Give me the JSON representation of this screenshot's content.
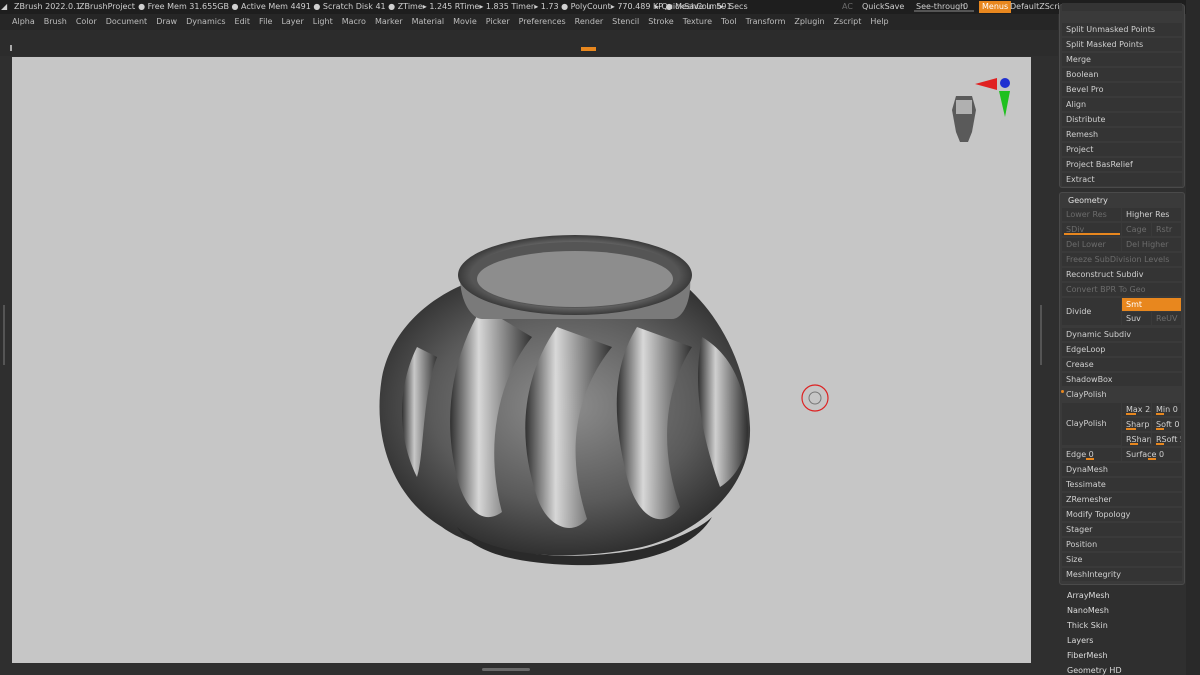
{
  "titlebar": {
    "app": "ZBrush 2022.0.1",
    "project": "ZBrushProject",
    "stats": ". ● Free Mem 31.655GB ● Active Mem 4491 ● Scratch Disk 41 ● ZTime▸ 1.245 RTime▸ 1.835 Timer▸ 1.73 ● PolyCount▸ 770.489 KP ● MeshCount▸ 1",
    "quicksave_timer": "▸ QuickSave In 59 Secs",
    "ac": "AC",
    "quicksave": "QuickSave",
    "seethrough_label": "See-through",
    "seethrough_value": "0",
    "seethrough_level": 0,
    "menus": "Menus",
    "script": "DefaultZScript"
  },
  "menubar": [
    "Alpha",
    "Brush",
    "Color",
    "Document",
    "Draw",
    "Dynamics",
    "Edit",
    "File",
    "Layer",
    "Light",
    "Macro",
    "Marker",
    "Material",
    "Movie",
    "Picker",
    "Preferences",
    "Render",
    "Stencil",
    "Stroke",
    "Texture",
    "Tool",
    "Transform",
    "Zplugin",
    "Zscript",
    "Help"
  ],
  "panel": {
    "top_items": [
      "Split Unmasked Points",
      "Split Masked Points",
      "Merge",
      "Boolean",
      "Bevel Pro",
      "Align",
      "Distribute",
      "Remesh",
      "Project",
      "Project BasRelief",
      "Extract"
    ],
    "geometry": {
      "title": "Geometry",
      "lower_res": "Lower Res",
      "higher_res": "Higher Res",
      "sdiv": "SDiv",
      "cage": "Cage",
      "rstr": "Rstr",
      "del_lower": "Del Lower",
      "del_higher": "Del Higher",
      "freeze": "Freeze SubDivision Levels",
      "reconstruct": "Reconstruct Subdiv",
      "convert": "Convert BPR To Geo",
      "divide": "Divide",
      "smt": "Smt",
      "suv": "Suv",
      "reuv": "ReUV",
      "items_a": [
        "Dynamic Subdiv",
        "EdgeLoop",
        "Crease",
        "ShadowBox"
      ],
      "claypolish_toggle": "ClayPolish",
      "claypolish": "ClayPolish",
      "max": "Max 25",
      "min": "Min 0",
      "sharp": "Sharp",
      "soft": "Soft 0",
      "rsharp": "RSharp",
      "rsoft": "RSoft 5",
      "edge": "Edge 0",
      "surface": "Surface 0",
      "items_b": [
        "DynaMesh",
        "Tessimate",
        "ZRemesher",
        "Modify Topology",
        "Stager",
        "Position",
        "Size",
        "MeshIntegrity"
      ]
    },
    "bottom_items": [
      "ArrayMesh",
      "NanoMesh",
      "Thick Skin",
      "Layers",
      "FiberMesh",
      "Geometry HD"
    ]
  },
  "colors": {
    "accent": "#e8871e",
    "viewport": "#c6c6c6",
    "panel": "#3a3a3a"
  }
}
